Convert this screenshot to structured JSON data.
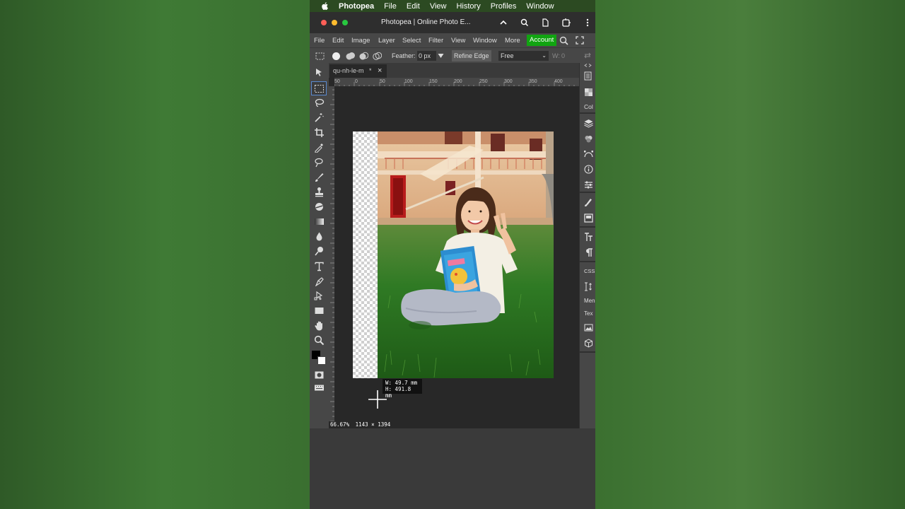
{
  "mac_menubar": {
    "app": "Photopea",
    "items": [
      "File",
      "Edit",
      "View",
      "History",
      "Profiles",
      "Window"
    ]
  },
  "browser": {
    "title": "Photopea | Online Photo E..."
  },
  "app_menu": {
    "items": [
      "File",
      "Edit",
      "Image",
      "Layer",
      "Select",
      "Filter",
      "View",
      "Window",
      "More"
    ],
    "account_label": "Account"
  },
  "options_bar": {
    "feather_label": "Feather:",
    "feather_value": "0 px",
    "refine_edge_label": "Refine Edge",
    "style_value": "Free",
    "width_label": "W:",
    "width_value": "0"
  },
  "document": {
    "tab_name": "qu-nh-le-m",
    "modified_marker": "*",
    "close_label": "×",
    "ruler_ticks": [
      "50",
      "0",
      "50",
      "100",
      "150",
      "200",
      "250",
      "300",
      "350",
      "400"
    ],
    "measure_w": "W:  49.7 mm",
    "measure_h": "H: 491.8 mm",
    "zoom": "66.67%",
    "dimensions": "1143 × 1394"
  },
  "right_panel": {
    "labels": [
      "Col",
      "CSS",
      "Men",
      "Tex"
    ]
  },
  "colors": {
    "accent": "#11a411",
    "panel": "#474747",
    "canvas_bg": "#282828"
  }
}
